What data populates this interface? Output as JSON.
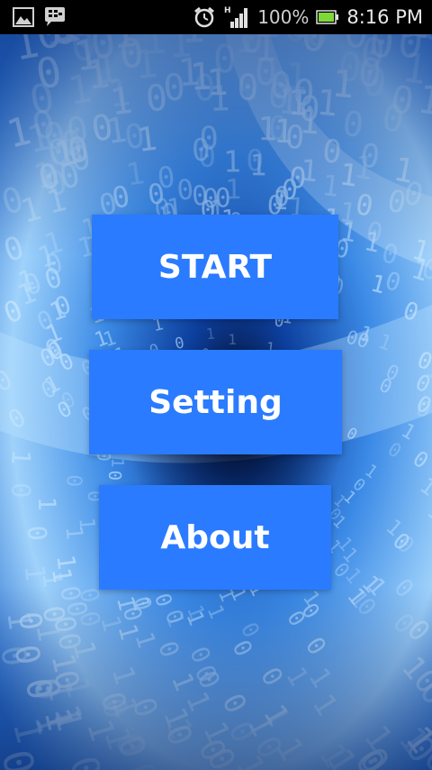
{
  "status_bar": {
    "battery_percent": "100%",
    "time": "8:16 PM",
    "network_type": "H",
    "icons": [
      "gallery-icon",
      "bbm-icon",
      "alarm-icon",
      "signal-icon",
      "battery-icon"
    ]
  },
  "menu": {
    "start_label": "START",
    "setting_label": "Setting",
    "about_label": "About"
  },
  "colors": {
    "button_bg": "#2a7bff",
    "button_text": "#ffffff",
    "status_bar_bg": "#000000",
    "battery_fill": "#7fd83a"
  }
}
